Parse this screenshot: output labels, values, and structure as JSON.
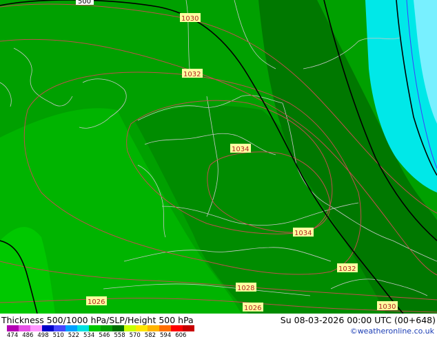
{
  "map": {
    "isobar_labels": [
      "1030",
      "1032",
      "1034",
      "1034",
      "1032",
      "1030",
      "1028",
      "1026",
      "1026"
    ],
    "height_label": "500",
    "colors": {
      "green_light": "#00c800",
      "green_mid": "#00a000",
      "green_dark": "#008800",
      "green_darkest": "#006e00",
      "cyan": "#00e8e8",
      "cyan_light": "#78f0ff",
      "isobar": "#c0504d",
      "border": "#c8c8c8",
      "height_line": "#000000"
    }
  },
  "footer": {
    "title": "Thickness 500/1000 hPa/SLP/Height 500 hPa",
    "datetime": "Su 08-03-2026 00:00 UTC (00+648)",
    "credit": "©weatheronline.co.uk"
  },
  "legend": {
    "ticks": [
      "474",
      "486",
      "498",
      "510",
      "522",
      "534",
      "546",
      "558",
      "570",
      "582",
      "594",
      "606"
    ],
    "colors": [
      "#b400b4",
      "#e650e6",
      "#ff96ff",
      "#0000c8",
      "#4646ff",
      "#00a0ff",
      "#00e1e1",
      "#00c800",
      "#00a000",
      "#006e00",
      "#c8ff00",
      "#ffe600",
      "#ffb400",
      "#ff6e00",
      "#ff0000",
      "#c80000"
    ]
  }
}
